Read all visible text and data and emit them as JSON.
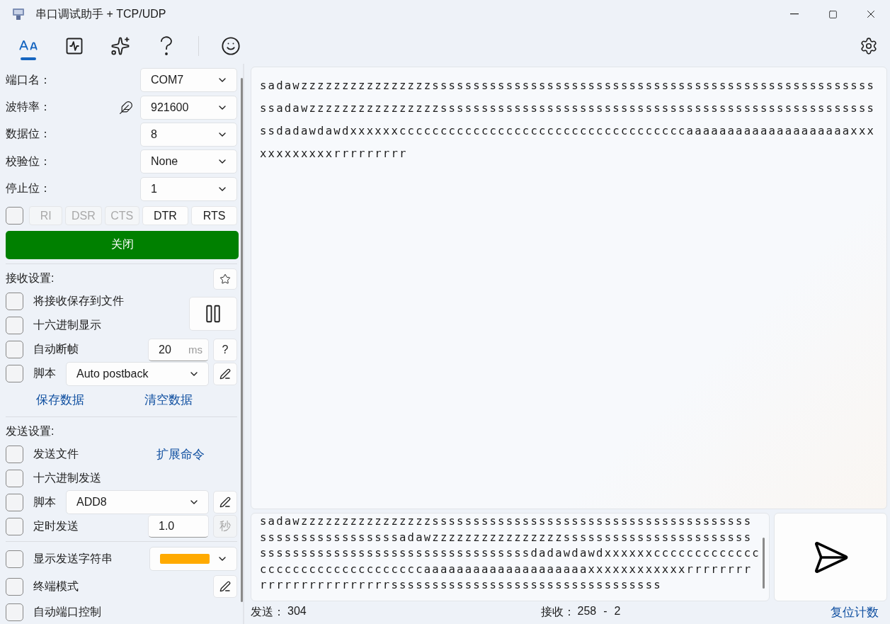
{
  "window": {
    "title": "串口调试助手 + TCP/UDP"
  },
  "toolbar": [
    {
      "kind": "text-size",
      "selected": true
    },
    {
      "kind": "monitor",
      "selected": false
    },
    {
      "kind": "tools",
      "selected": false
    },
    {
      "kind": "help",
      "selected": false
    },
    {
      "kind": "emoji",
      "selected": false
    }
  ],
  "port": {
    "fields": [
      {
        "label": "端口名：",
        "value": "COM7",
        "editable": false
      },
      {
        "label": "波特率：",
        "value": "921600",
        "editable": true
      },
      {
        "label": "数据位：",
        "value": "8",
        "editable": false
      },
      {
        "label": "校验位：",
        "value": "None",
        "editable": false
      },
      {
        "label": "停止位：",
        "value": "1",
        "editable": false
      }
    ],
    "flow_checked": false,
    "signals": [
      {
        "label": "RI",
        "disabled": true
      },
      {
        "label": "DSR",
        "disabled": true
      },
      {
        "label": "CTS",
        "disabled": true
      },
      {
        "label": "DTR",
        "disabled": false
      },
      {
        "label": "RTS",
        "disabled": false
      }
    ],
    "open_button": "关闭"
  },
  "receive": {
    "title": "接收设置:",
    "options": [
      {
        "kind": "check",
        "label": "将接收保存到文件",
        "checked": false
      },
      {
        "kind": "check",
        "label": "十六进制显示",
        "checked": false
      },
      {
        "kind": "timeout",
        "label": "自动断帧",
        "checked": false,
        "value": "20",
        "unit": "ms",
        "help": "?"
      },
      {
        "kind": "script",
        "label": "脚本",
        "checked": false,
        "value": "Auto postback"
      }
    ],
    "links": [
      "保存数据",
      "清空数据"
    ]
  },
  "send": {
    "title": "发送设置:",
    "options": [
      {
        "kind": "link",
        "label": "发送文件",
        "checked": false,
        "link": "扩展命令"
      },
      {
        "kind": "check",
        "label": "十六进制发送",
        "checked": false
      },
      {
        "kind": "script",
        "label": "脚本",
        "checked": false,
        "value": "ADD8"
      },
      {
        "kind": "timer",
        "label": "定时发送",
        "checked": false,
        "value": "1.0",
        "unit": "秒"
      }
    ],
    "display_options": [
      {
        "kind": "color",
        "label": "显示发送字符串",
        "checked": false,
        "color": "#ffaa00"
      },
      {
        "kind": "edit",
        "label": "终端模式",
        "checked": false
      },
      {
        "kind": "check",
        "label": "自动端口控制",
        "checked": false
      }
    ]
  },
  "receive_text": [
    "sadawzzzzzzzzzzzzzzzzssssssssssssssssssssssssssssssssssssssssssssssssssssss",
    "ssadawzzzzzzzzzzzzzzzzsssssssssssssssssssssssssssssssssssssssssssssssssssss",
    "ssdadawdawdxxxxxxcccccccccccccccccccccccccccccccccccaaaaaaaaaaaaaaaaaaaaxxx",
    "xxxxxxxxxrrrrrrrrr"
  ],
  "send_text": [
    "sadawzzzzzzzzzzzzzzzzsssssssssssssssssssssssssssssssssssssss",
    "sssssssssssssssssadawzzzzzzzzzzzzzzzzsssssssssssssssssssssss",
    "sssssssssssssssssssssssssssssssssdadawdawdxxxxxxccccccccccccc",
    "ccccccccccccccccccccaaaaaaaaaaaaaaaaaaaaxxxxxxxxxxxxrrrrrrrr",
    "rrrrrrrrrrrrrrrrsssssssssssssssssssssssssssssssss"
  ],
  "status": {
    "sent_label": "发送：",
    "sent": "304",
    "received_label": "接收：",
    "received": "258",
    "separator": "-",
    "received_extra": "2",
    "reset": "复位计数"
  }
}
